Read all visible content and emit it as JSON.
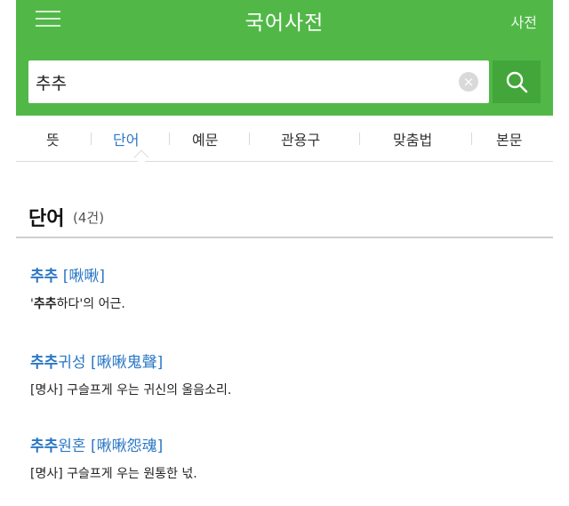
{
  "header": {
    "title": "국어사전",
    "dict_link": "사전",
    "menu_icon": "hamburger-menu-icon",
    "brand_color": "#51b848"
  },
  "search": {
    "value": "추추",
    "clear_icon": "clear-x-icon",
    "search_icon": "magnifier-icon"
  },
  "tabs": [
    {
      "label": "뜻",
      "active": false
    },
    {
      "label": "단어",
      "active": true
    },
    {
      "label": "예문",
      "active": false
    },
    {
      "label": "관용구",
      "active": false
    },
    {
      "label": "맞춤법",
      "active": false
    },
    {
      "label": "본문",
      "active": false
    }
  ],
  "section": {
    "title": "단어",
    "count": "(4건)"
  },
  "entries": [
    {
      "headword": "추추",
      "suffix": "",
      "hanja": "[啾啾]",
      "desc_pre": "'",
      "desc_bold": "추추",
      "desc_post": "하다'의 어근."
    },
    {
      "headword": "추추",
      "suffix": "귀성",
      "hanja": "[啾啾鬼聲]",
      "desc_pre": "[명사] 구슬프게 우는 귀신의 울음소리.",
      "desc_bold": "",
      "desc_post": ""
    },
    {
      "headword": "추추",
      "suffix": "원혼",
      "hanja": "[啾啾怨魂]",
      "desc_pre": "[명사] 구슬프게 우는 원통한 넋.",
      "desc_bold": "",
      "desc_post": ""
    }
  ],
  "link_color": "#2b78c5"
}
